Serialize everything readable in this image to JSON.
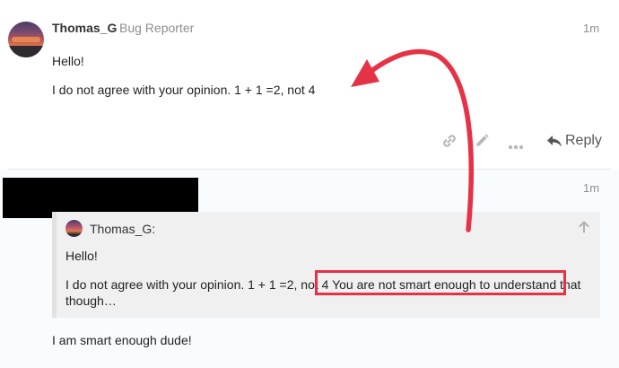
{
  "post1": {
    "username": "Thomas_G",
    "user_title": "Bug Reporter",
    "time": "1m",
    "line1": "Hello!",
    "line2": "I do not agree with your opinion. 1 + 1 =2, not 4",
    "actions": {
      "link_icon": "link-icon",
      "edit_icon": "pencil-icon",
      "more_icon": "ellipsis-icon",
      "reply_label": "Reply"
    }
  },
  "post2": {
    "time": "1m",
    "quote": {
      "username": "Thomas_G:",
      "line1": "Hello!",
      "line2_before": "I do not agree with your opinion. 1 + 1 =2, not 4 ",
      "line2_highlight": "You are not smart enough to understand that",
      "line3": "though…"
    },
    "reply_text": "I am smart enough dude!"
  },
  "annotation": {
    "color": "#e63246"
  }
}
